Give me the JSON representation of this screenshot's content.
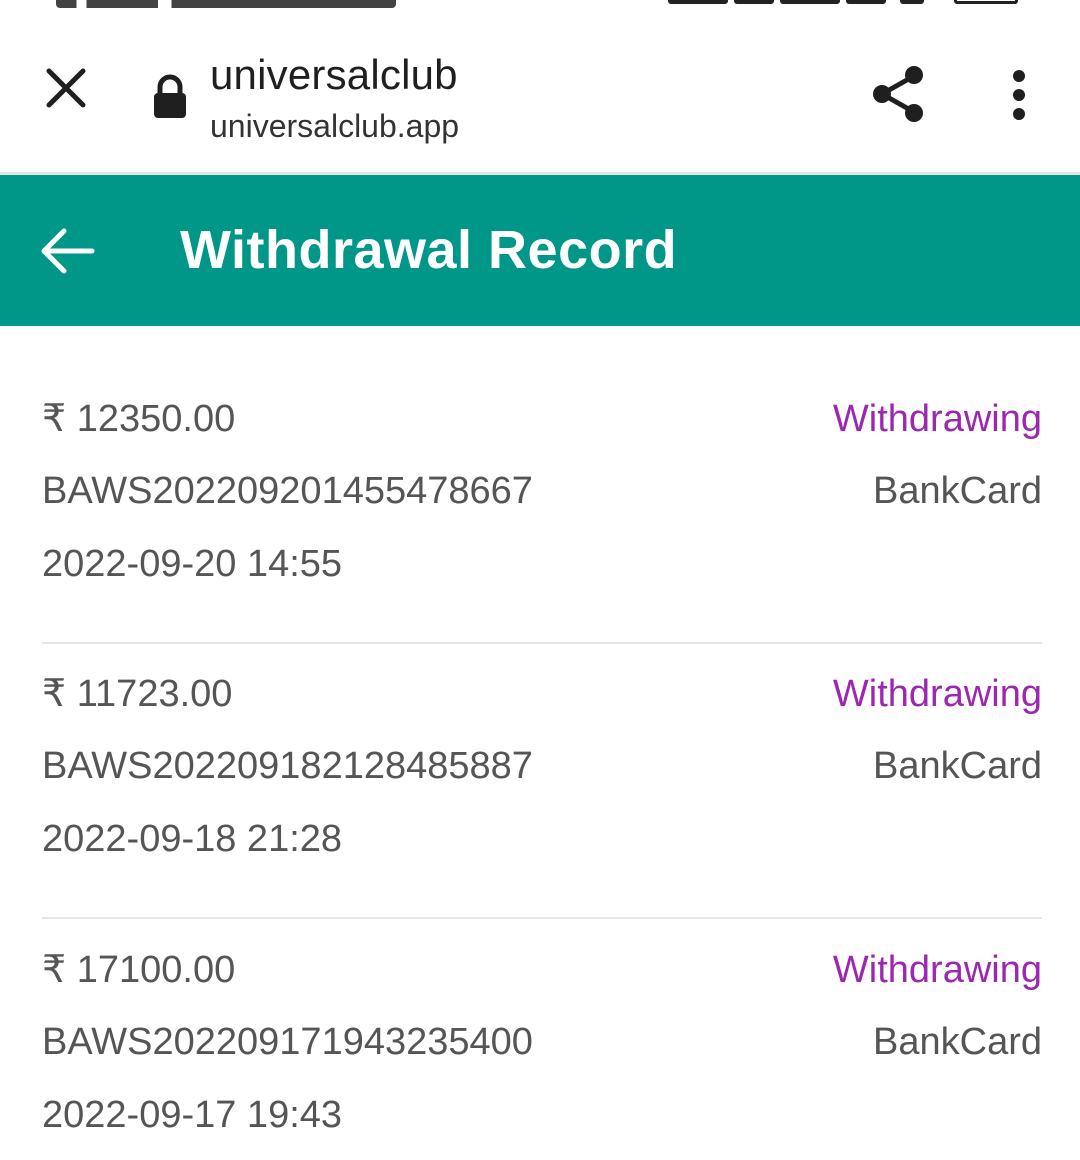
{
  "browser": {
    "site_title": "universalclub",
    "site_domain": "universalclub.app"
  },
  "header": {
    "title": "Withdrawal Record"
  },
  "records": [
    {
      "amount": "₹ 12350.00",
      "status": "Withdrawing",
      "order_id": "BAWS20220920145547866 7",
      "method": "BankCard",
      "time": "2022-09-20 14:55"
    },
    {
      "amount": "₹ 11723.00",
      "status": "Withdrawing",
      "order_id": "BAWS20220918212848588 7",
      "method": "BankCard",
      "time": "2022-09-18 21:28"
    },
    {
      "amount": "₹ 17100.00",
      "status": "Withdrawing",
      "order_id": "BAWS20220917194323540 0",
      "method": "BankCard",
      "time": "2022-09-17 19:43"
    }
  ],
  "colors": {
    "appbar": "#009688",
    "status": "#9c27b0",
    "text": "#555555"
  },
  "icons": {
    "close": "close-icon",
    "lock": "lock-icon",
    "share": "share-icon",
    "more": "more-vert-icon",
    "back": "arrow-back-icon"
  }
}
